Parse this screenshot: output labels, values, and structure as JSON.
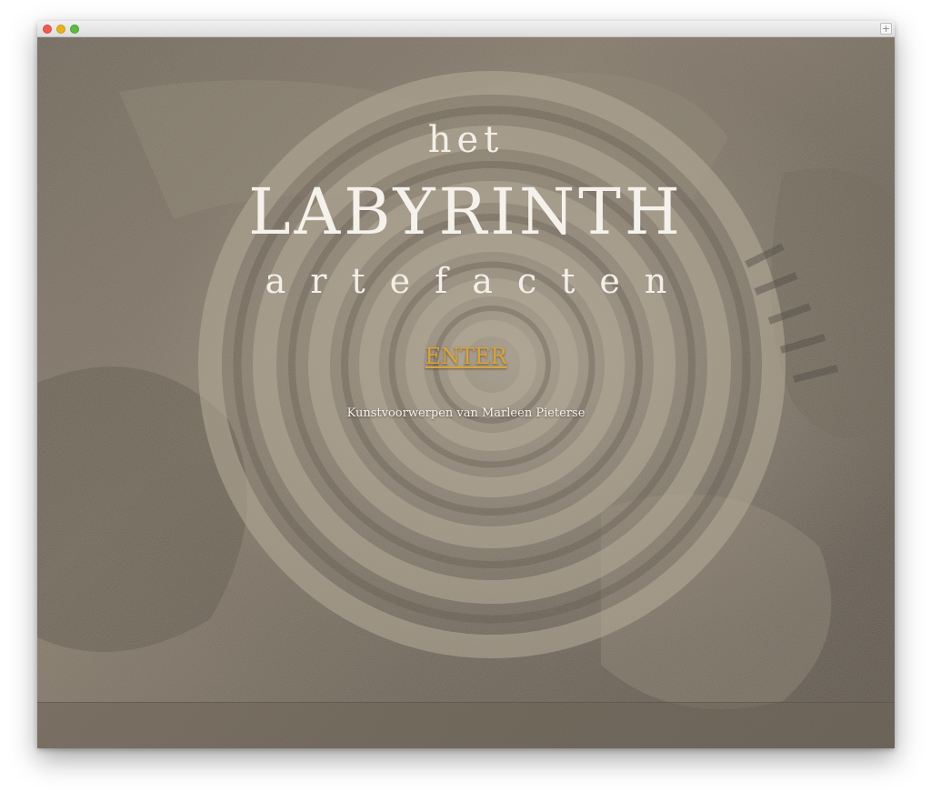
{
  "window": {
    "controls": {
      "close_icon": "close-dot-icon",
      "minimize_icon": "minimize-dot-icon",
      "maximize_icon": "maximize-dot-icon"
    },
    "new_tab_label": "+"
  },
  "logo": {
    "line1": "het",
    "line2": "LABYRINTH",
    "line3": "artefacten"
  },
  "enter_link": {
    "label": "ENTER"
  },
  "tagline": "Kunstvoorwerpen van Marleen Pieterse",
  "colors": {
    "title_text": "#f5f2ec",
    "enter_link": "#d9a43c",
    "background_stone": "#766c5f"
  }
}
